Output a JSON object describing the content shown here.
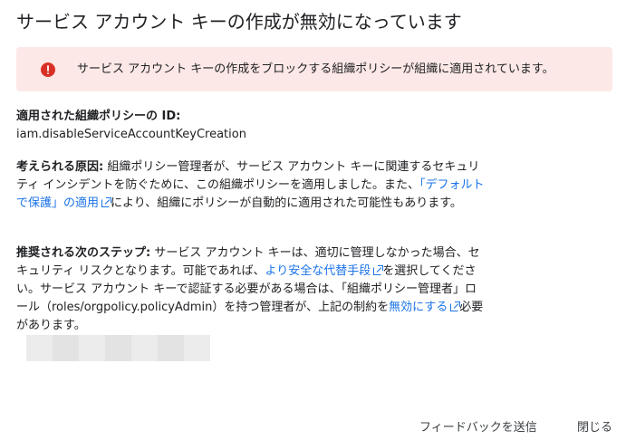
{
  "dialog": {
    "title": "サービス アカウント キーの作成が無効になっています"
  },
  "error_banner": {
    "message": "サービス アカウント キーの作成をブロックする組織ポリシーが組織に適用されています。",
    "color": "#d93025",
    "background": "#fce8e6"
  },
  "policy": {
    "label": "適用された組織ポリシーの ID:",
    "id": "iam.disableServiceAccountKeyCreation"
  },
  "cause": {
    "label": "考えられる原因:",
    "text_1": " 組織ポリシー管理者が、サービス アカウント キーに関連するセキュリティ インシデントを防ぐために、この組織ポリシーを適用しました。また、",
    "link": "「デフォルトで保護」の適用",
    "link_icon": "external-link-icon",
    "text_2": "により、組織にポリシーが自動的に適用された可能性もあります。"
  },
  "steps": {
    "label": "推奨される次のステップ:",
    "text_1": " サービス アカウント キーは、適切に管理しなかった場合、セキュリティ リスクとなります。可能であれば、",
    "link_1": "より安全な代替手段",
    "text_2": "を選択してください。サービス アカウント キーで認証する必要がある場合は、「組織ポリシー管理者」ロール（roles/orgpolicy.policyAdmin）を持つ管理者が、上記の制約を",
    "link_2": "無効にする",
    "text_3": "必要があります。"
  },
  "footer": {
    "feedback_label": "フィードバックを送信",
    "close_label": "閉じる"
  },
  "colors": {
    "link": "#1a73e8",
    "text": "#202124"
  }
}
